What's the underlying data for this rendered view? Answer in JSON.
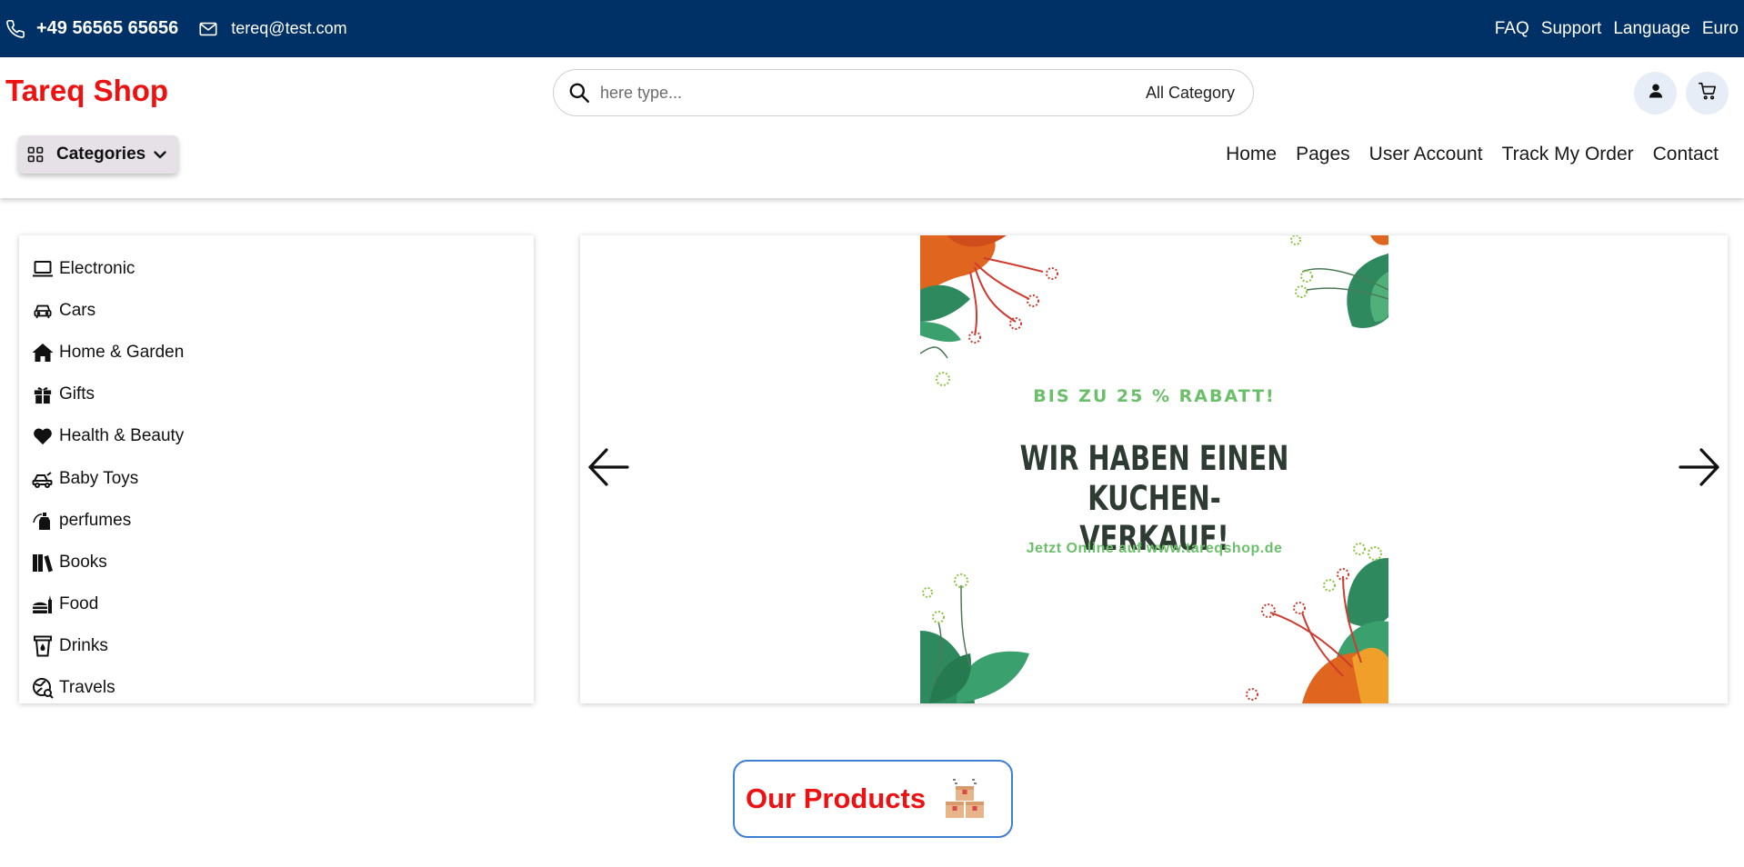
{
  "topbar": {
    "phone": "+49 56565 65656",
    "email": "tereq@test.com",
    "links": [
      "FAQ",
      "Support",
      "Language",
      "Euro"
    ]
  },
  "header": {
    "logo": "Tareq Shop",
    "search_placeholder": "here type...",
    "search_category": "All Category",
    "categories_button": "Categories",
    "nav": [
      "Home",
      "Pages",
      "User Account",
      "Track My Order",
      "Contact"
    ]
  },
  "sidebar": {
    "items": [
      {
        "label": "Electronic",
        "icon": "laptop-icon"
      },
      {
        "label": "Cars",
        "icon": "car-icon"
      },
      {
        "label": "Home & Garden",
        "icon": "house-icon"
      },
      {
        "label": "Gifts",
        "icon": "gift-icon"
      },
      {
        "label": "Health & Beauty",
        "icon": "heart-icon"
      },
      {
        "label": "Baby Toys",
        "icon": "toy-car-icon"
      },
      {
        "label": "perfumes",
        "icon": "perfume-icon"
      },
      {
        "label": "Books",
        "icon": "books-icon"
      },
      {
        "label": "Food",
        "icon": "food-icon"
      },
      {
        "label": "Drinks",
        "icon": "cup-icon"
      },
      {
        "label": "Travels",
        "icon": "globe-icon"
      }
    ]
  },
  "banner": {
    "subtitle": "BIS ZU 25 % RABATT!",
    "headline": "WIR HABEN EINEN KUCHEN-VERKAUF!",
    "online": "Jetzt Online auf www.tareqshop.de"
  },
  "products": {
    "title": "Our Products"
  },
  "colors": {
    "topbar": "#003166",
    "brand_red": "#ee1111",
    "banner_green": "#6cbf6a",
    "outline_blue": "#3d7fd1"
  }
}
